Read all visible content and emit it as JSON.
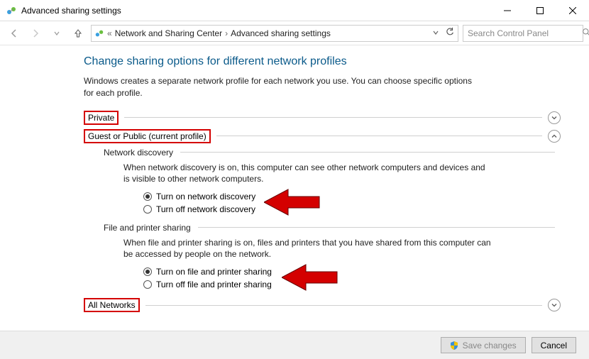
{
  "window": {
    "title": "Advanced sharing settings"
  },
  "breadcrumb": {
    "root_glyph": "«",
    "crumb1": "Network and Sharing Center",
    "crumb2": "Advanced sharing settings"
  },
  "search": {
    "placeholder": "Search Control Panel"
  },
  "page": {
    "heading": "Change sharing options for different network profiles",
    "subtext": "Windows creates a separate network profile for each network you use. You can choose specific options for each profile."
  },
  "sections": {
    "private": {
      "label": "Private"
    },
    "guest": {
      "label": "Guest or Public (current profile)"
    },
    "all": {
      "label": "All Networks"
    }
  },
  "guest": {
    "network_discovery": {
      "title": "Network discovery",
      "desc": "When network discovery is on, this computer can see other network computers and devices and is visible to other network computers.",
      "opt_on": "Turn on network discovery",
      "opt_off": "Turn off network discovery"
    },
    "file_printer": {
      "title": "File and printer sharing",
      "desc": "When file and printer sharing is on, files and printers that you have shared from this computer can be accessed by people on the network.",
      "opt_on": "Turn on file and printer sharing",
      "opt_off": "Turn off file and printer sharing"
    }
  },
  "footer": {
    "save": "Save changes",
    "cancel": "Cancel"
  }
}
